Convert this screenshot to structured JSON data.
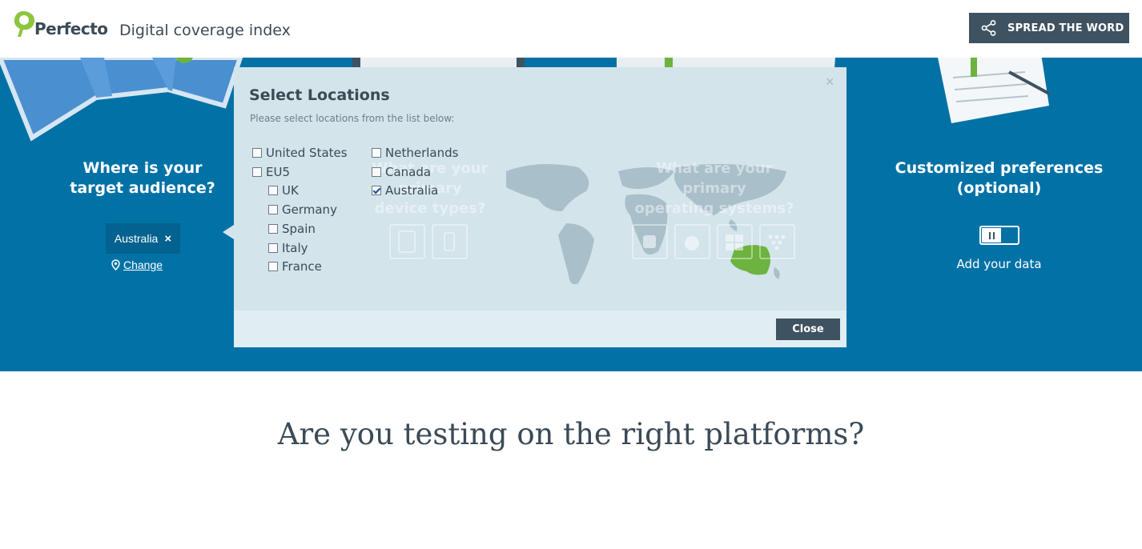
{
  "header": {
    "brand": "Perfecto",
    "app_title": "Digital coverage index",
    "spread_label": "SPREAD THE WORD"
  },
  "audience": {
    "title_line1": "Where is your",
    "title_line2": "target audience?",
    "selected_location": "Australia",
    "remove_symbol": "×",
    "change_label": "Change"
  },
  "preferences": {
    "title_line1": "Customized preferences",
    "title_line2": "(optional)",
    "add_data_label": "Add your data"
  },
  "modal": {
    "title": "Select Locations",
    "subtitle": "Please select locations from the list below:",
    "close_x": "×",
    "close_label": "Close",
    "locations": [
      {
        "label": "United States",
        "checked": false
      },
      {
        "label": "EU5",
        "checked": false
      },
      {
        "label": "UK",
        "checked": false
      },
      {
        "label": "Germany",
        "checked": false
      },
      {
        "label": "Spain",
        "checked": false
      },
      {
        "label": "Italy",
        "checked": false
      },
      {
        "label": "France",
        "checked": false
      },
      {
        "label": "Netherlands",
        "checked": false
      },
      {
        "label": "Canada",
        "checked": false
      },
      {
        "label": "Australia",
        "checked": true
      }
    ],
    "behind": {
      "devices_line1": "What are your primary",
      "devices_line2": "device types?",
      "os_line1": "What are your primary",
      "os_line2": "operating systems?"
    }
  },
  "tagline": "Are you testing on the right platforms?",
  "colors": {
    "hero": "#0272a6",
    "button": "#3f5261",
    "modal": "#d3e4eb",
    "highlight": "#6cb33f"
  },
  "icons": [
    "perfecto-logo-icon",
    "share-icon",
    "location-pin-icon",
    "toggle-icon",
    "world-map-icon",
    "tablet-icon",
    "phone-icon",
    "android-icon",
    "apple-icon",
    "windows-icon",
    "blackberry-icon"
  ]
}
